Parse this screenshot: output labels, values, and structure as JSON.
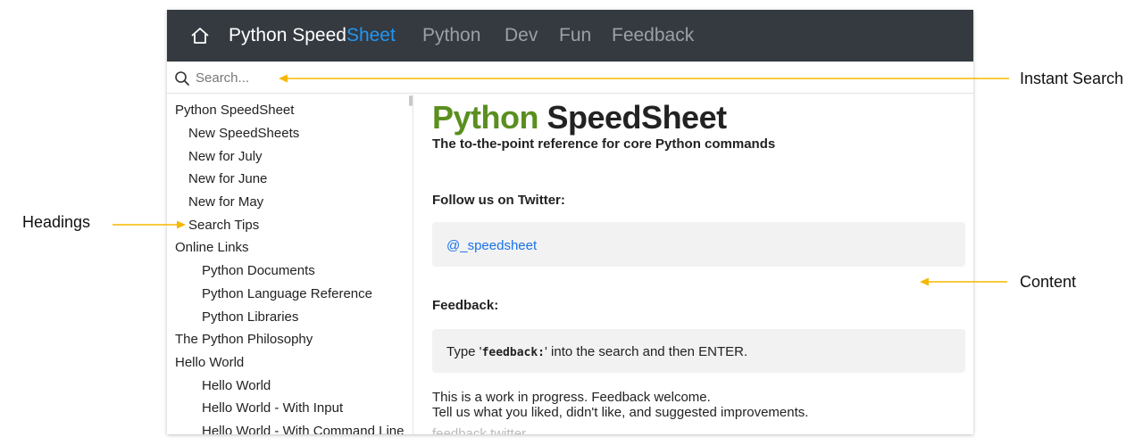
{
  "navbar": {
    "home_icon": "home-icon",
    "brand_prefix": "Python Speed",
    "brand_suffix": "Sheet",
    "items": [
      "Python",
      "Dev",
      "Fun",
      "Feedback"
    ]
  },
  "search": {
    "icon": "search-icon",
    "placeholder": "Search..."
  },
  "sidebar": {
    "items": [
      {
        "label": "Python SpeedSheet",
        "level": 0
      },
      {
        "label": "New SpeedSheets",
        "level": 1
      },
      {
        "label": "New for July",
        "level": 1
      },
      {
        "label": "New for June",
        "level": 1
      },
      {
        "label": "New for May",
        "level": 1
      },
      {
        "label": "Search Tips",
        "level": 1
      },
      {
        "label": "Online Links",
        "level": 0
      },
      {
        "label": "Python Documents",
        "level": 2
      },
      {
        "label": "Python Language Reference",
        "level": 2
      },
      {
        "label": "Python Libraries",
        "level": 2
      },
      {
        "label": "The Python Philosophy",
        "level": 0
      },
      {
        "label": "Hello World",
        "level": 0
      },
      {
        "label": "Hello World",
        "level": 2
      },
      {
        "label": "Hello World - With Input",
        "level": 2
      },
      {
        "label": "Hello World - With Command Line",
        "level": 2
      }
    ]
  },
  "content": {
    "title_green": "Python",
    "title_dark": "SpeedSheet",
    "subtitle": "The to-the-point reference for core Python commands",
    "twitter_heading": "Follow us on Twitter:",
    "twitter_handle": "@_speedsheet",
    "feedback_heading": "Feedback:",
    "feedback_prefix": "Type '",
    "feedback_code": "feedback:",
    "feedback_suffix": "' into the search and then ENTER.",
    "paragraph_line1": "This is a work in progress. Feedback welcome.",
    "paragraph_line2": "Tell us what you liked, didn't like, and suggested improvements.",
    "tags": "feedback  twitter"
  },
  "annotations": {
    "instant_search": "Instant Search",
    "headings": "Headings",
    "content": "Content"
  },
  "colors": {
    "navbar_bg": "#343a40",
    "brand_accent": "#2196f3",
    "title_green": "#5a8f1f",
    "link": "#1a73e8",
    "arrow": "#f5b800"
  }
}
